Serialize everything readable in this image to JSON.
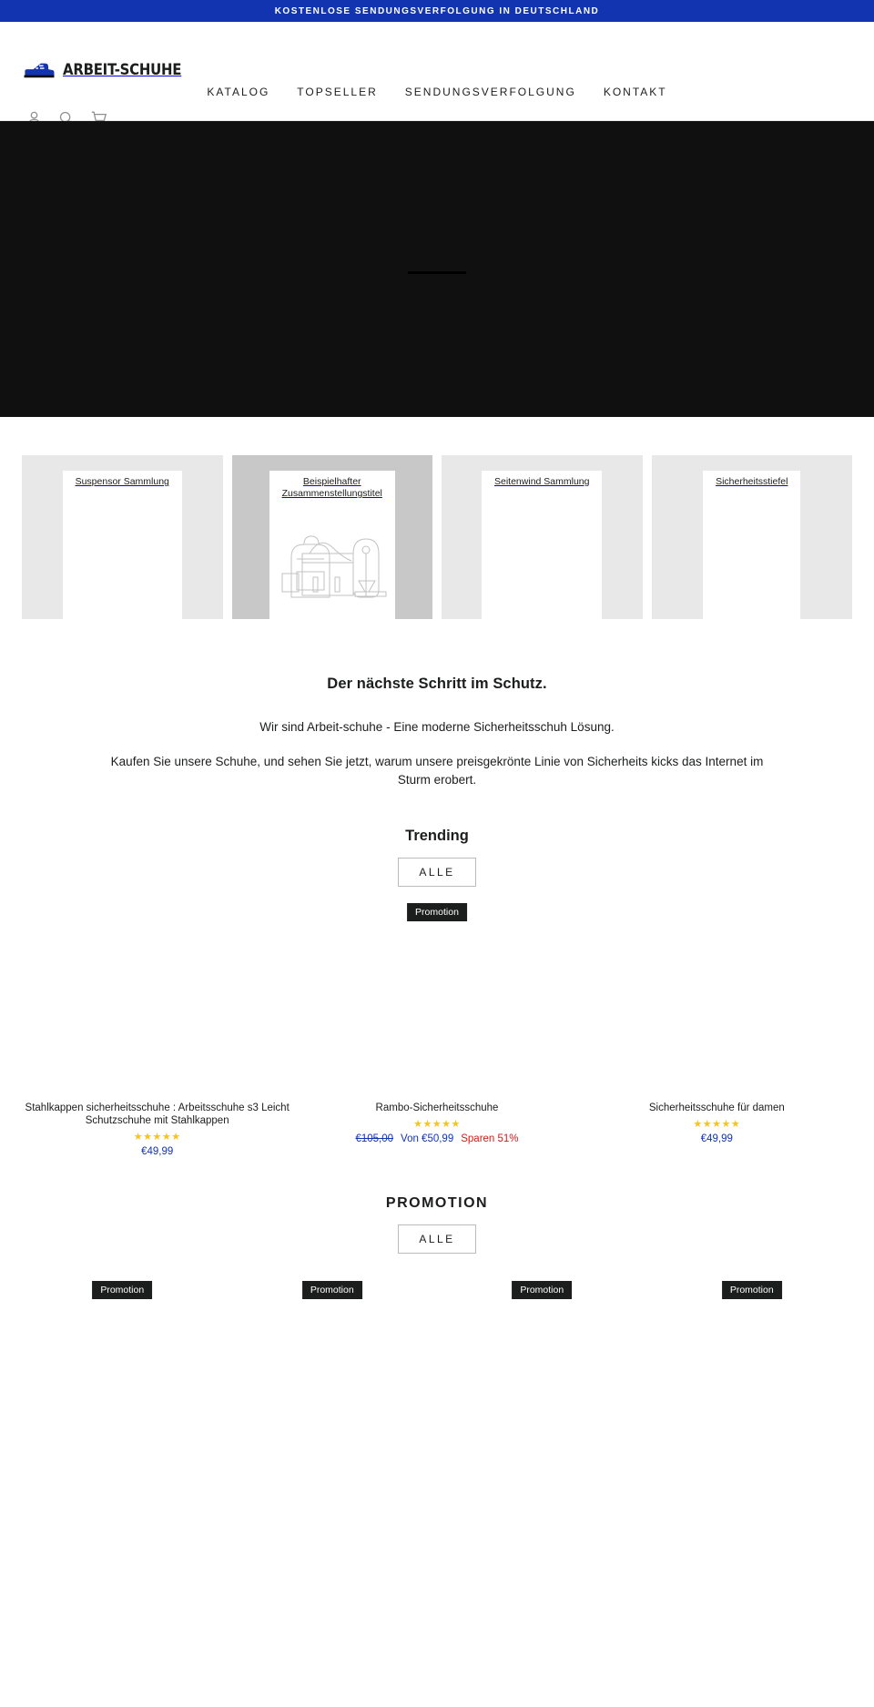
{
  "announcement": {
    "text": "Kostenlose Sendungsverfolgung in Deutschland"
  },
  "header": {
    "brand": "ARBEIT-SCHUHE",
    "nav": [
      {
        "label": "Katalog"
      },
      {
        "label": "Topseller"
      },
      {
        "label": "Sendungsverfolgung"
      },
      {
        "label": "Kontakt"
      }
    ],
    "icons": [
      {
        "name": "account-icon"
      },
      {
        "name": "search-icon"
      },
      {
        "name": "cart-icon"
      }
    ]
  },
  "collections": [
    {
      "title": "Suspensor Sammlung",
      "placeholder": false
    },
    {
      "title": "Beispielhafter\nZusammenstellungstitel",
      "placeholder": true
    },
    {
      "title": "Seitenwind Sammlung",
      "placeholder": false
    },
    {
      "title": "Sicherheitsstiefel",
      "placeholder": false
    }
  ],
  "richtext": {
    "heading": "Der nächste Schritt im Schutz.",
    "paragraph1": "Wir sind Arbeit-schuhe - Eine moderne Sicherheitsschuh Lösung.",
    "paragraph2": "Kaufen Sie unsere Schuhe, und sehen Sie jetzt, warum unsere preisgekrönte Linie von Sicherheits kicks das Internet im Sturm erobert."
  },
  "trending": {
    "heading": "Trending",
    "button": "Alle",
    "products": [
      {
        "badge": "",
        "title": "Stahlkappen sicherheitsschuhe : Arbeitsschuhe s3 Leicht Schutzschuhe mit Stahlkappen",
        "stars": "★★★★★",
        "price": "€49,99",
        "price_old": "",
        "price_new": "",
        "price_save": ""
      },
      {
        "badge": "Promotion",
        "title": "Rambo-Sicherheitsschuhe",
        "stars": "★★★★★",
        "price": "",
        "price_old": "€105,00",
        "price_new": "Von €50,99",
        "price_save": "Sparen 51%"
      },
      {
        "badge": "",
        "title": "Sicherheitsschuhe für damen",
        "stars": "★★★★★",
        "price": "€49,99",
        "price_old": "",
        "price_new": "",
        "price_save": ""
      }
    ]
  },
  "promotion": {
    "heading": "Promotion",
    "button": "Alle",
    "cards": [
      {
        "badge": "Promotion"
      },
      {
        "badge": "Promotion"
      },
      {
        "badge": "Promotion"
      },
      {
        "badge": "Promotion"
      }
    ]
  },
  "colors": {
    "accent": "#1234b0",
    "hero_bg": "#101010",
    "badge_bg": "#1c1d1d",
    "star": "#f5c518",
    "sale": "#d11a1a",
    "card_bg": "#e8e8e8",
    "card_placeholder_bg": "#c8c8c8"
  }
}
